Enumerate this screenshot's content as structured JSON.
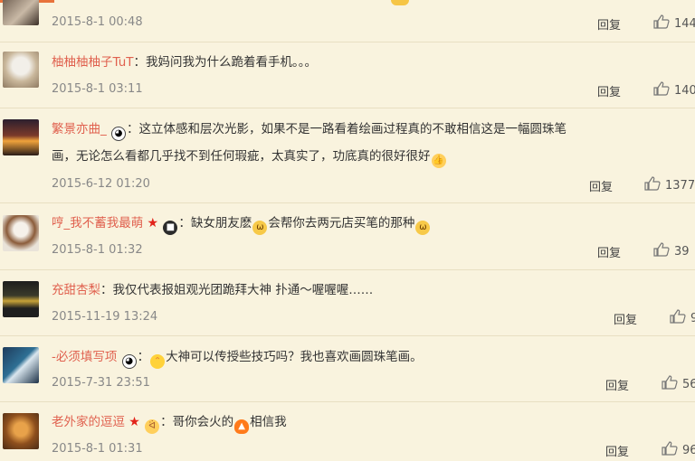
{
  "reply_label": "回复",
  "comments": [
    {
      "user": "",
      "text": "",
      "time": "2015-8-1 00:48",
      "likes": "144"
    },
    {
      "user": "柚柚柚柚子TuT",
      "text": "我妈问我为什么跪着看手机。。。",
      "time": "2015-8-1 03:11",
      "likes": "140"
    },
    {
      "user": "繁景亦曲_",
      "text": "这立体感和层次光影，如果不是一路看着绘画过程真的不敢相信这是一幅圆珠笔",
      "text2": "画，无论怎么看都几乎找不到任何瑕疵，太真实了，功底真的很好很好",
      "time": "2015-6-12 01:20",
      "likes": "1377"
    },
    {
      "user": "哼_我不蓄我最萌",
      "text": "缺女朋友麽",
      "text_b": "会帮你去两元店买笔的那种",
      "time": "2015-8-1 01:32",
      "likes": "39"
    },
    {
      "user": "充甜杏梨",
      "text": "我仅代表报姐观光团跪拜大神 扑通～喔喔喔……",
      "time": "2015-11-19 13:24",
      "likes": "9"
    },
    {
      "user": "-必须填写项",
      "text": "大神可以传授些技巧吗？我也喜欢画圆珠笔画。",
      "time": "2015-7-31 23:51",
      "likes": "56"
    },
    {
      "user": "老外家的逗逗",
      "text": "哥你会火的",
      "text_b": "相信我",
      "time": "2015-8-1 01:31",
      "likes": "96"
    }
  ],
  "icons": {
    "thumb": "thumbs-up-icon",
    "panda": "panda-emoji-icon",
    "cat": "cat-emoji-icon",
    "star": "red-star-badge-icon",
    "fire": "fire-emoji-icon",
    "clap": "thumbs-up-emoji-icon"
  }
}
